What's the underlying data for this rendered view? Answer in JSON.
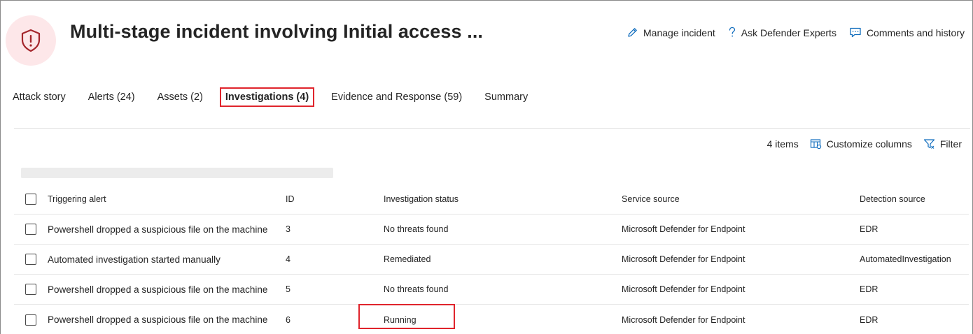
{
  "header": {
    "title": "Multi-stage incident involving Initial access ...",
    "icon": "shield-alert-icon",
    "actions": [
      {
        "label": "Manage incident",
        "icon": "pencil-icon"
      },
      {
        "label": "Ask Defender Experts",
        "icon": "question-icon"
      },
      {
        "label": "Comments and history",
        "icon": "comment-icon"
      }
    ]
  },
  "tabs": [
    {
      "label": "Attack story"
    },
    {
      "label": "Alerts (24)"
    },
    {
      "label": "Assets (2)"
    },
    {
      "label": "Investigations (4)",
      "selected": true
    },
    {
      "label": "Evidence and Response (59)"
    },
    {
      "label": "Summary"
    }
  ],
  "toolbar": {
    "count": "4 items",
    "customize": "Customize columns",
    "filter": "Filter"
  },
  "table": {
    "columns": [
      "Triggering alert",
      "ID",
      "Investigation status",
      "Service source",
      "Detection source"
    ],
    "rows": [
      {
        "alert": "Powershell dropped a suspicious file on the machine",
        "id": "3",
        "status": "No threats found",
        "service": "Microsoft Defender for Endpoint",
        "detection": "EDR"
      },
      {
        "alert": "Automated investigation started manually",
        "id": "4",
        "status": "Remediated",
        "service": "Microsoft Defender for Endpoint",
        "detection": "AutomatedInvestigation"
      },
      {
        "alert": "Powershell dropped a suspicious file on the machine",
        "id": "5",
        "status": "No threats found",
        "service": "Microsoft Defender for Endpoint",
        "detection": "EDR"
      },
      {
        "alert": "Powershell dropped a suspicious file on the machine",
        "id": "6",
        "status": "Running",
        "service": "Microsoft Defender for Endpoint",
        "detection": "EDR"
      }
    ]
  },
  "colors": {
    "accent": "#0f6cbd",
    "highlight": "#e0242c",
    "shield_bg": "#fde7e9",
    "shield": "#a4262c"
  }
}
